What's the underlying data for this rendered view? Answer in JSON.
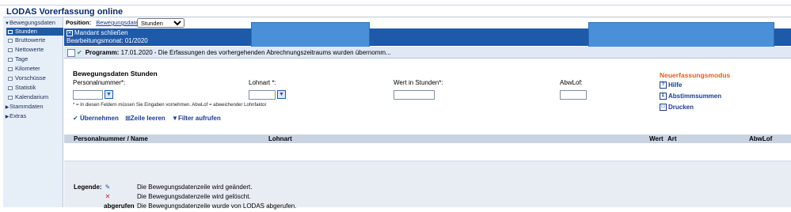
{
  "app": {
    "title": "LODAS Vorerfassung online"
  },
  "sidebar": {
    "groups": [
      {
        "label": "Bewegungsdaten",
        "expanded": true
      },
      {
        "label": "Stammdaten",
        "expanded": false
      },
      {
        "label": "Extras",
        "expanded": false
      }
    ],
    "items": [
      {
        "label": "Stunden",
        "active": true
      },
      {
        "label": "Bruttowerte"
      },
      {
        "label": "Nettowerte"
      },
      {
        "label": "Tage"
      },
      {
        "label": "Kilometer"
      },
      {
        "label": "Vorschüsse"
      },
      {
        "label": "Statistik"
      },
      {
        "label": "Kalendarium"
      }
    ]
  },
  "position": {
    "label": "Position:",
    "link": "Bewegungsdaten",
    "select_value": "Stunden"
  },
  "mandant": {
    "close_label": "Mandant schließen",
    "period": "Bearbeitungsmonat: 01/2020"
  },
  "message": {
    "program_label": "Programm:",
    "text": "17.01.2020 -  Die Erfassungen des vorhergehenden Abrechnungszeitraums wurden übernomm..."
  },
  "form": {
    "title": "Bewegungsdaten Stunden",
    "labels": {
      "personalnummer": "Personalnummer*:",
      "lohnart": "Lohnart *:",
      "wert": "Wert in Stunden*:",
      "abwlof": "AbwLof:"
    },
    "hint": "* = In diesen Feldern müssen Sie Eingaben vornehmen.    AbwLof = abweichender Lohnfaktor",
    "actions": {
      "uebernehmen": "Übernehmen",
      "zeile_leeren": "Zeile leeren",
      "filter": "Filter aufrufen"
    }
  },
  "right_panel": {
    "mode": "Neuerfassungsmodus",
    "hilfe": "Hilfe",
    "abstimmsummen": "Abstimmsummen",
    "drucken": "Drucken"
  },
  "table": {
    "columns": [
      "Personalnummer / Name",
      "Lohnart",
      "Wert",
      "Art",
      "AbwLof"
    ]
  },
  "legend": {
    "title": "Legende:",
    "changed": "Die Bewegungsdatenzeile wird geändert.",
    "deleted": "Die Bewegungsdatenzeile wird gelöscht.",
    "fetched_label": "abgerufen",
    "fetched": "Die Bewegungsdatenzeile wurde von LODAS abgerufen."
  },
  "colors": {
    "accent": "#1f5aa8",
    "mode": "#e06020",
    "redaction": "#4a90d9"
  }
}
